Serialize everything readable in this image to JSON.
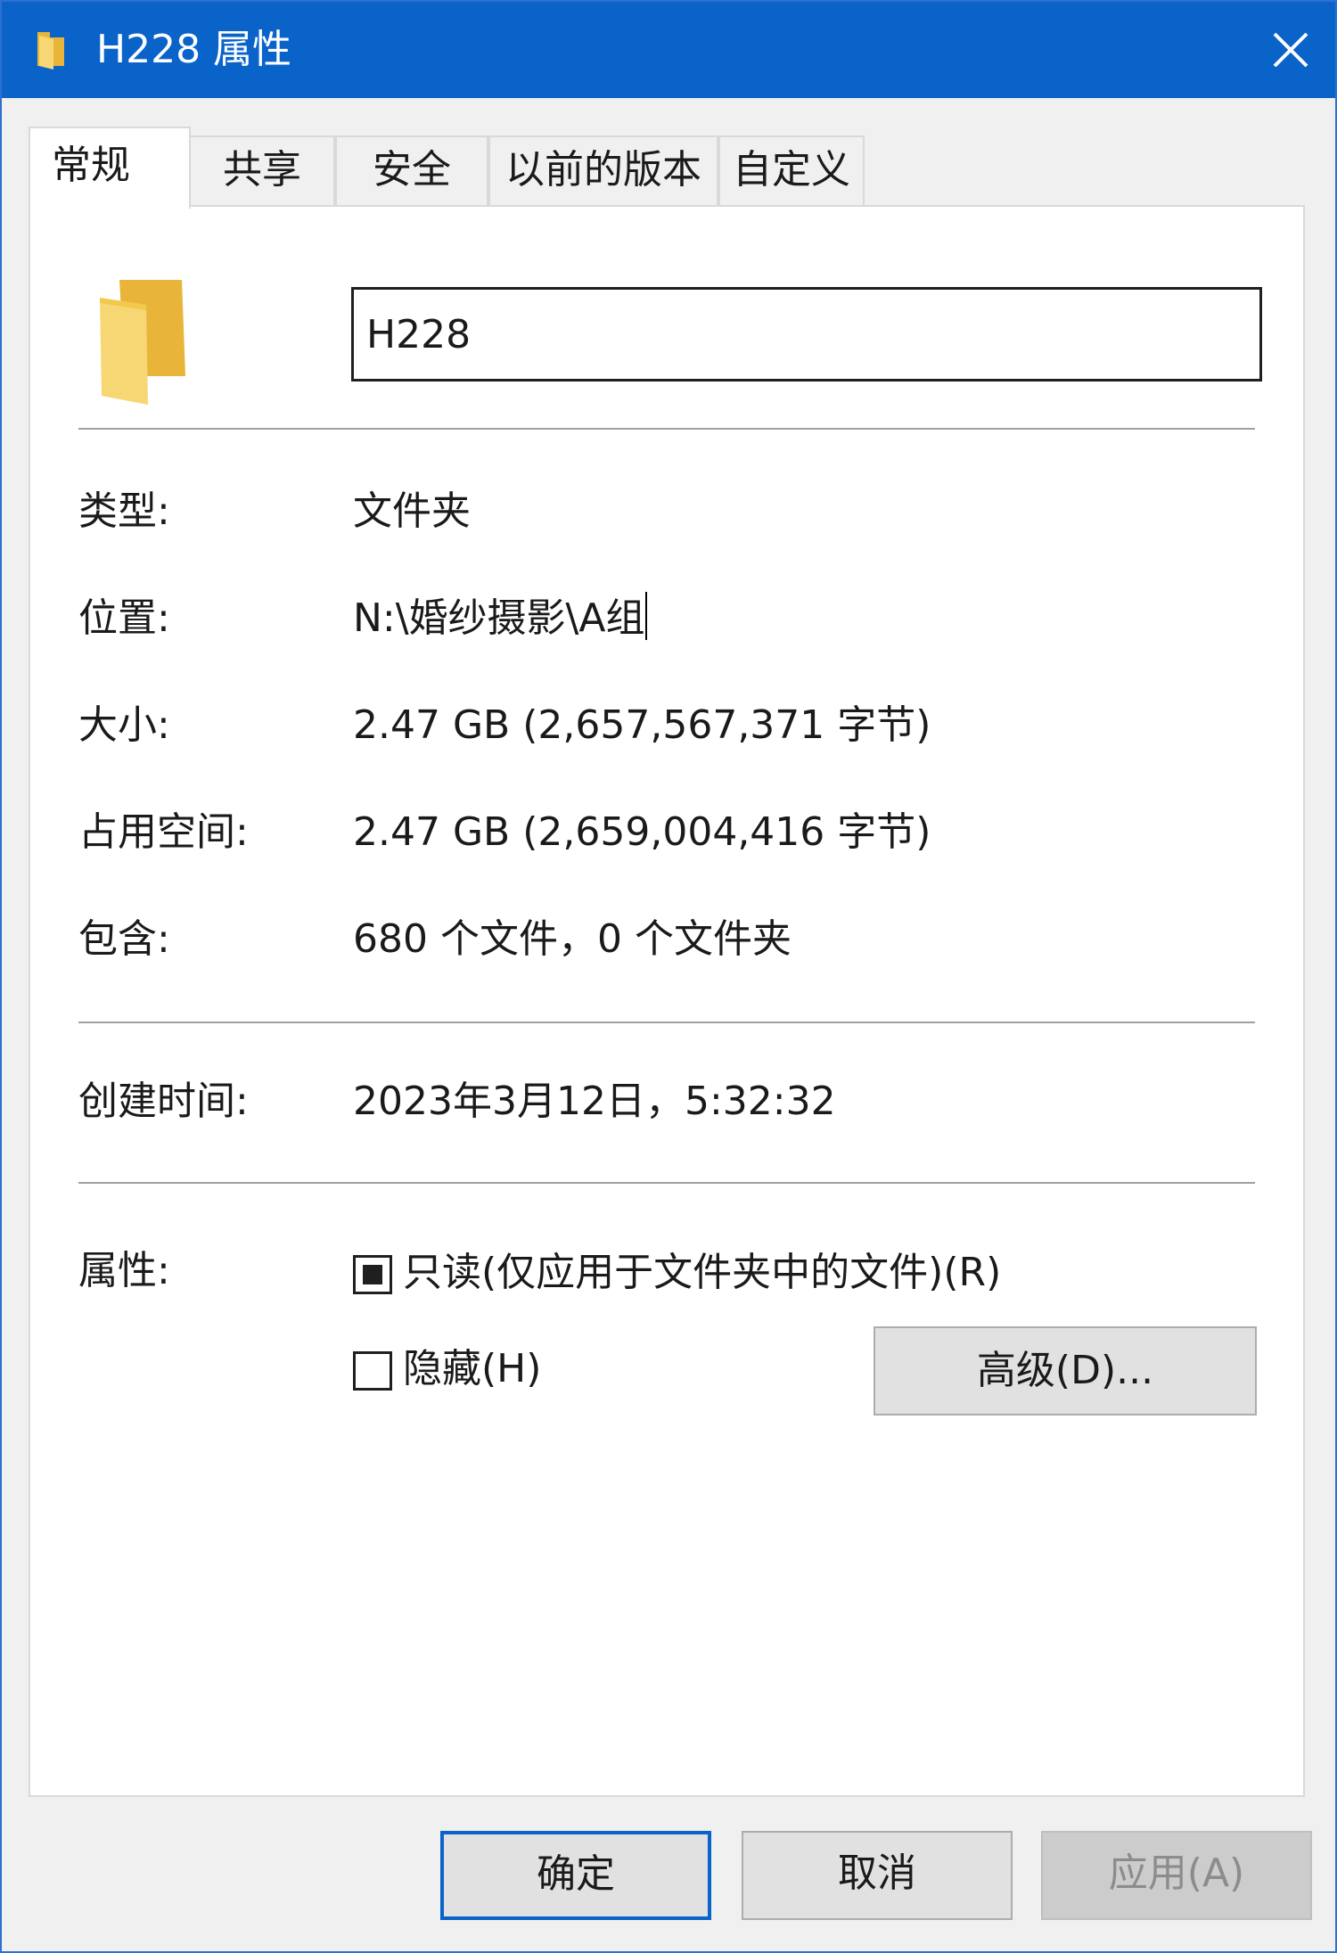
{
  "window": {
    "title": "H228 属性"
  },
  "tabs": [
    {
      "label": "常规",
      "active": true
    },
    {
      "label": "共享",
      "active": false
    },
    {
      "label": "安全",
      "active": false
    },
    {
      "label": "以前的版本",
      "active": false
    },
    {
      "label": "自定义",
      "active": false
    }
  ],
  "general": {
    "folder_name": "H228",
    "type_label": "类型:",
    "type_value": "文件夹",
    "location_label": "位置:",
    "location_value": "N:\\婚纱摄影\\A组",
    "size_label": "大小:",
    "size_value": "2.47 GB (2,657,567,371 字节)",
    "size_on_disk_label": "占用空间:",
    "size_on_disk_value": "2.47 GB (2,659,004,416 字节)",
    "contains_label": "包含:",
    "contains_value": "680 个文件，0 个文件夹",
    "created_label": "创建时间:",
    "created_value": "2023年3月12日，5:32:32",
    "attributes_label": "属性:",
    "readonly_label": "只读(仅应用于文件夹中的文件)(R)",
    "readonly_state": "indeterminate",
    "hidden_label": "隐藏(H)",
    "hidden_checked": false,
    "advanced_button": "高级(D)..."
  },
  "buttons": {
    "ok": "确定",
    "cancel": "取消",
    "apply": "应用(A)",
    "apply_enabled": false
  },
  "icons": {
    "folder": "folder-icon",
    "close": "close-icon"
  },
  "colors": {
    "titlebar": "#0a63c9",
    "folder": "#f2c94c",
    "accent": "#0a63c9"
  }
}
